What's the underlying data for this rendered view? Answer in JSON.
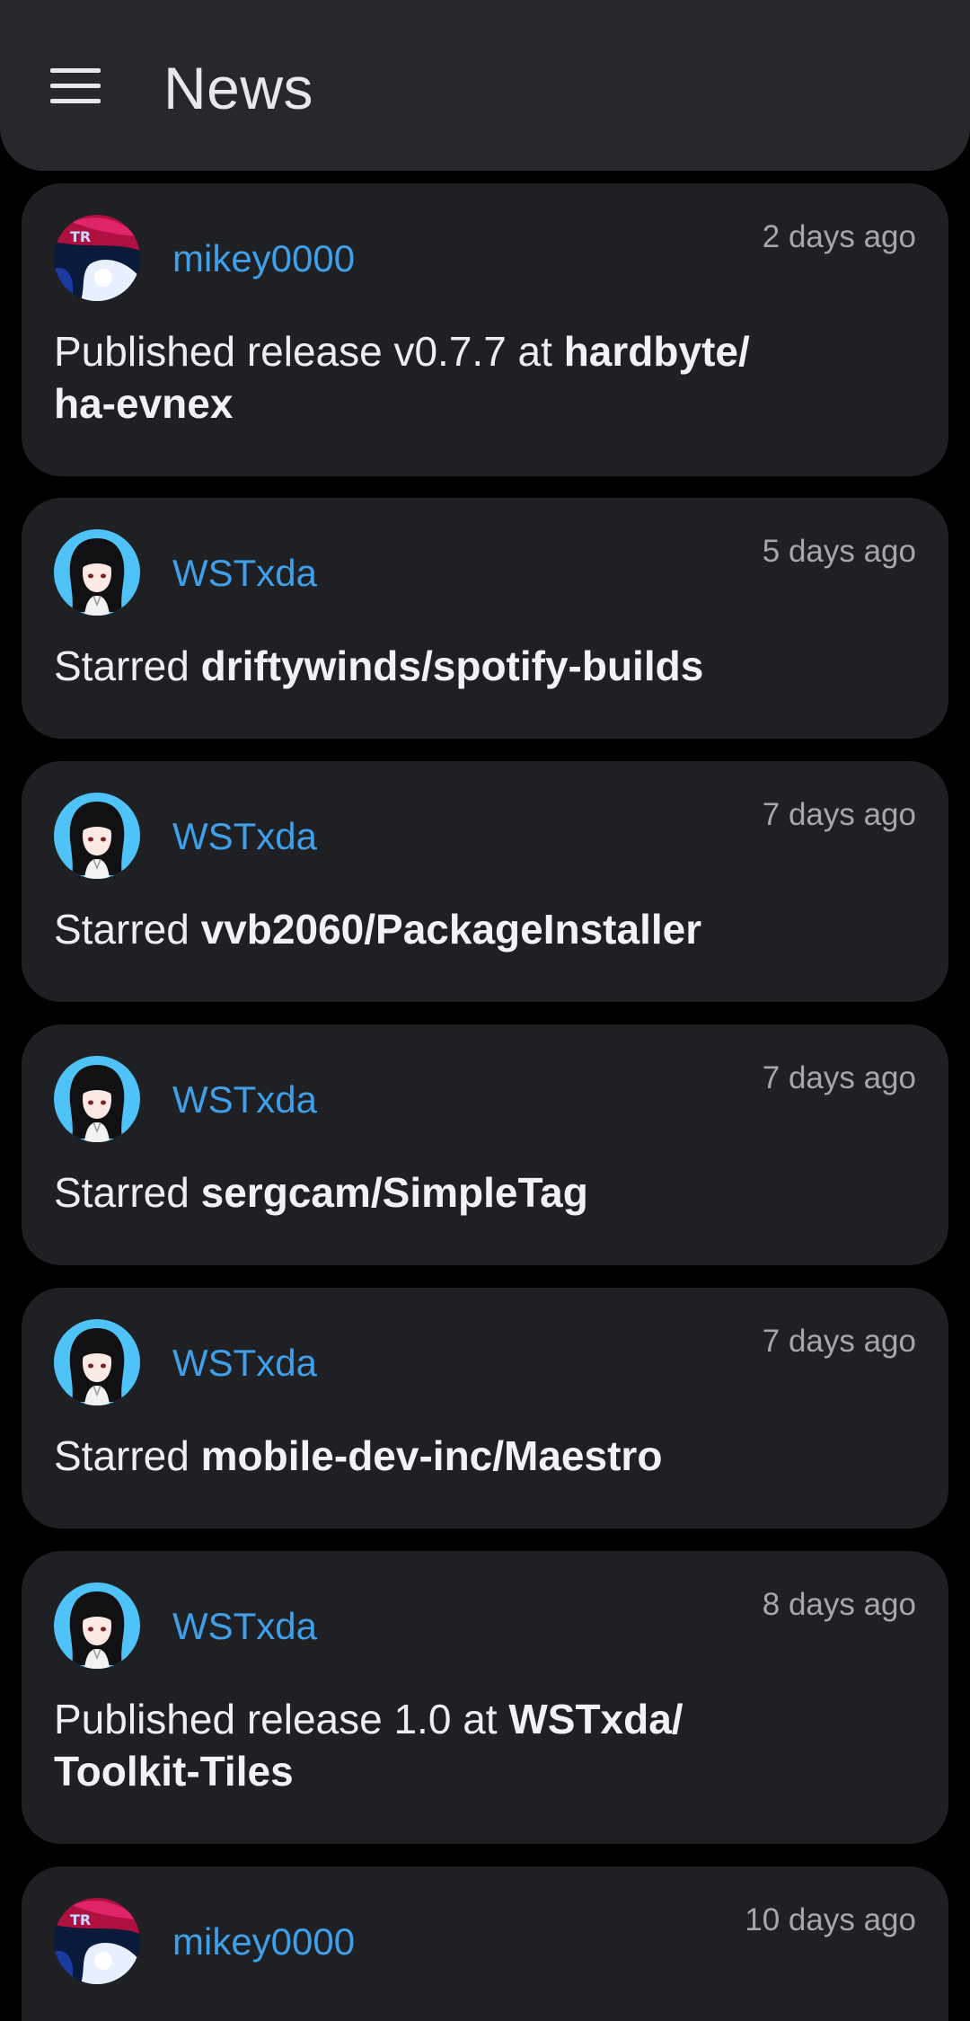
{
  "appbar": {
    "title": "News",
    "menu_icon": "hamburger-menu-icon"
  },
  "colors": {
    "background": "#000000",
    "appbar": "#27282c",
    "card": "#1f2023",
    "username": "#3f9fe8",
    "timestamp": "#a6a7ab",
    "text": "#eeeef0"
  },
  "feed": [
    {
      "user": "mikey0000",
      "avatar": "red-blue-avatar",
      "time": "2 days ago",
      "action": "Published release v0.7.7 at ",
      "repo_line1": "hardbyte/",
      "repo_line2": "ha-evnex"
    },
    {
      "user": "WSTxda",
      "avatar": "anime-girl-avatar",
      "time": "5 days ago",
      "action": "Starred ",
      "repo": "driftywinds/spotify-builds"
    },
    {
      "user": "WSTxda",
      "avatar": "anime-girl-avatar",
      "time": "7 days ago",
      "action": "Starred ",
      "repo": "vvb2060/PackageInstaller"
    },
    {
      "user": "WSTxda",
      "avatar": "anime-girl-avatar",
      "time": "7 days ago",
      "action": "Starred ",
      "repo": "sergcam/SimpleTag"
    },
    {
      "user": "WSTxda",
      "avatar": "anime-girl-avatar",
      "time": "7 days ago",
      "action": "Starred ",
      "repo": "mobile-dev-inc/Maestro"
    },
    {
      "user": "WSTxda",
      "avatar": "anime-girl-avatar",
      "time": "8 days ago",
      "action": "Published release 1.0 at ",
      "repo_line1": "WSTxda/",
      "repo_line2": "Toolkit-Tiles"
    },
    {
      "user": "mikey0000",
      "avatar": "red-blue-avatar",
      "time": "10 days ago"
    }
  ]
}
